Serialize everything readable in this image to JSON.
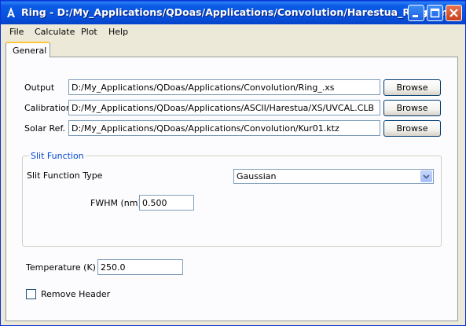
{
  "window": {
    "title": "Ring - D:/My_Applications/QDoas/Applications/Convolution/Harestua_Ring.xml"
  },
  "menu": [
    "File",
    "Calculate",
    "Plot",
    "Help"
  ],
  "tabs": [
    "General"
  ],
  "files": {
    "output": {
      "label": "Output",
      "value": "D:/My_Applications/QDoas/Applications/Convolution/Ring_.xs",
      "button": "Browse"
    },
    "calibration": {
      "label": "Calibration",
      "value": "D:/My_Applications/QDoas/Applications/ASCII/Harestua/XS/UVCAL.CLB",
      "button": "Browse"
    },
    "solar_ref": {
      "label": "Solar Ref.",
      "value": "D:/My_Applications/QDoas/Applications/Convolution/Kur01.ktz",
      "button": "Browse"
    }
  },
  "slit_function": {
    "group_title": "Slit Function",
    "type_label": "Slit Function Type",
    "type_value": "Gaussian",
    "fwhm_label": "FWHM (nm)",
    "fwhm_value": "0.500"
  },
  "temperature": {
    "label": "Temperature (K)",
    "value": "250.0"
  },
  "remove_header": {
    "label": "Remove Header",
    "checked": false
  },
  "colors": {
    "titlebar": "#0750dd",
    "accent": "#0046d5",
    "tab_highlight": "#ffc83c"
  }
}
